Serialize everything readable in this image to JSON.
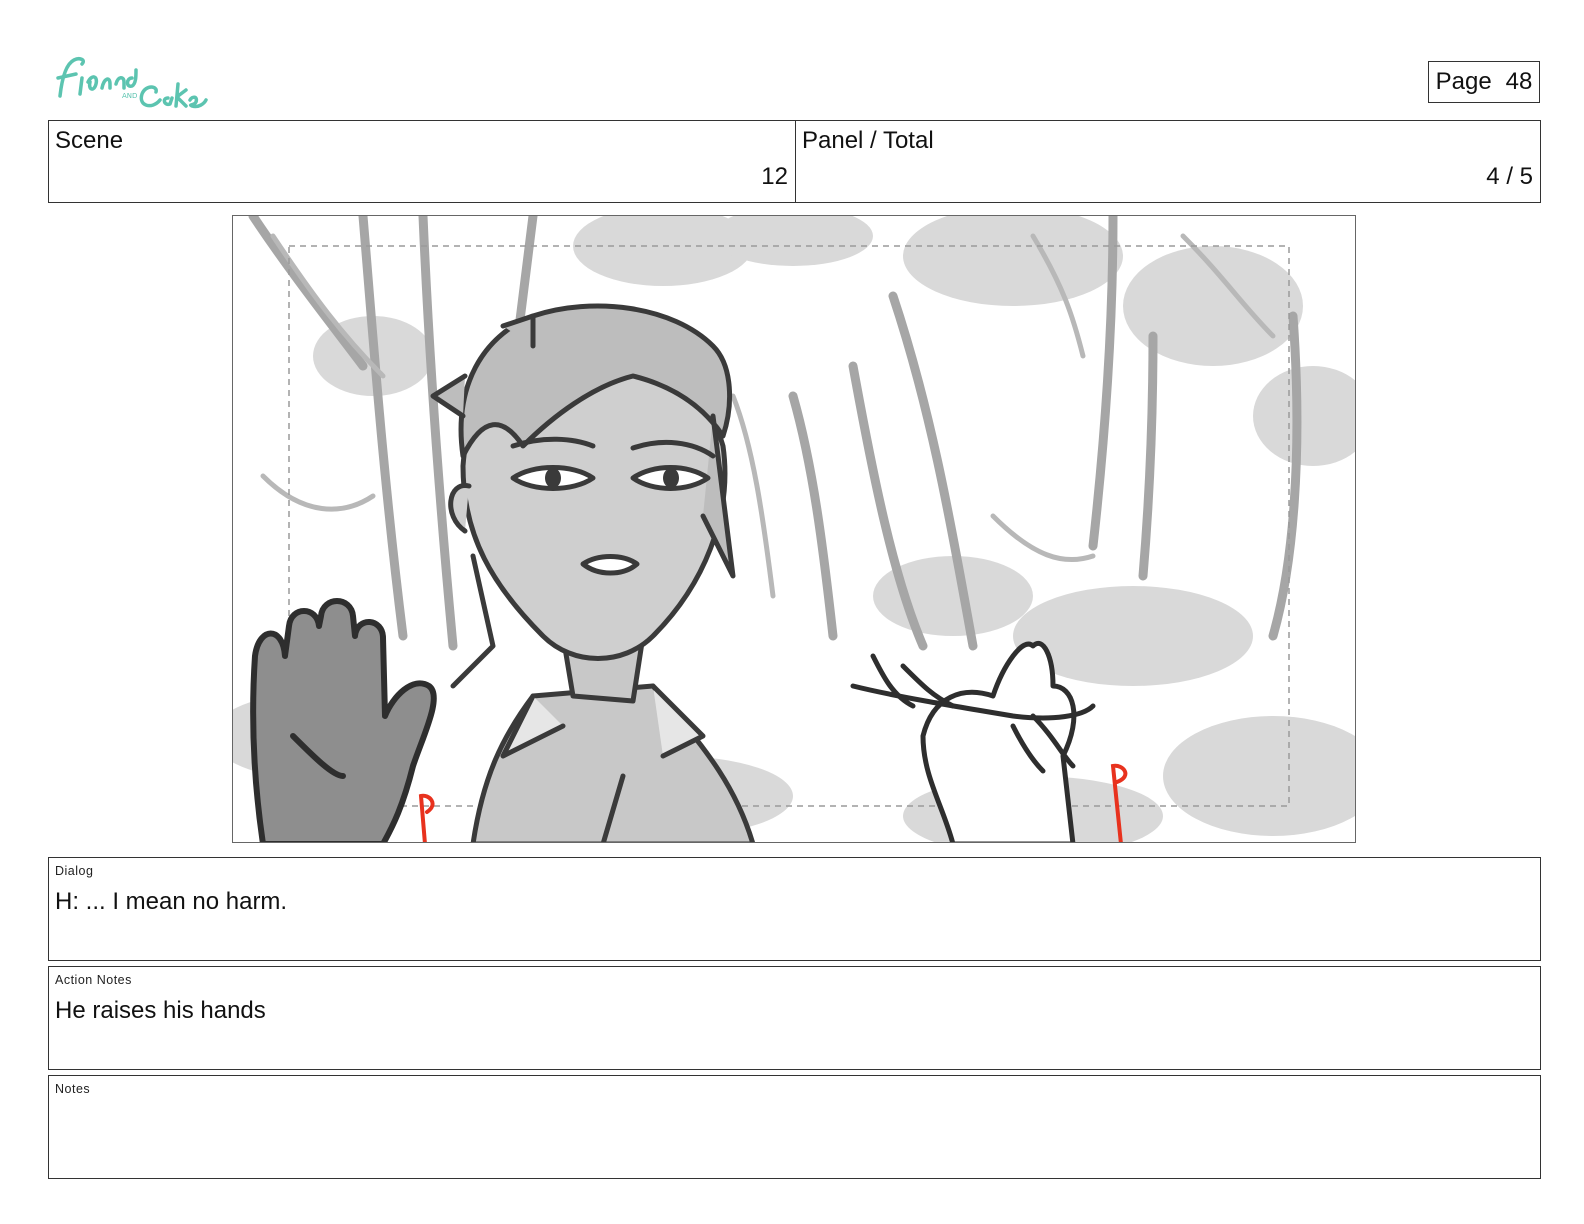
{
  "logo": {
    "text": "Fionna and Cake",
    "icon": "fionna-and-cake-logo",
    "color": "#5cc4b0"
  },
  "page": {
    "label": "Page",
    "number": "48"
  },
  "header": {
    "scene_label": "Scene",
    "scene_value": "12",
    "panel_label": "Panel / Total",
    "panel_value": "4 / 5"
  },
  "panel_image": {
    "icon": "storyboard-sketch",
    "description_icon": "forest-character-raised-hands"
  },
  "dialog": {
    "label": "Dialog",
    "text": "H: ... I mean no harm."
  },
  "action_notes": {
    "label": "Action Notes",
    "text": "He raises his hands"
  },
  "notes": {
    "label": "Notes",
    "text": ""
  },
  "colors": {
    "border": "#333333",
    "sketch_dark": "#3a3a3a",
    "sketch_fill": "#c8c8c8",
    "accent_red": "#e8321e"
  }
}
